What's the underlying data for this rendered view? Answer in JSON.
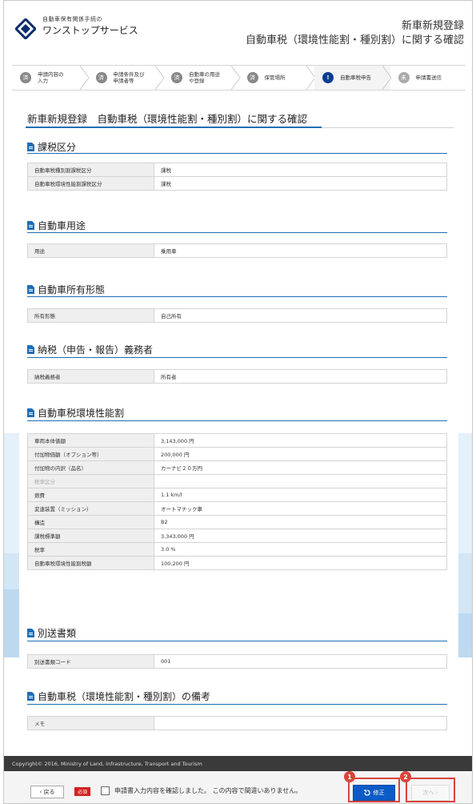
{
  "header": {
    "logo_small": "自動車保有関係手続の",
    "logo_big": "ワンストップサービス",
    "title_line1": "新車新規登録",
    "title_line2": "自動車税（環境性能割・種別割）に関する確認"
  },
  "steps": [
    {
      "num": "済",
      "label": "申請内容の入力"
    },
    {
      "num": "済",
      "label": "申請条件及び申請者等"
    },
    {
      "num": "済",
      "label": "自動車の用途や登録"
    },
    {
      "num": "済",
      "label": "保管場所"
    },
    {
      "num": "!",
      "label": "自動車税申告"
    },
    {
      "num": "未",
      "label": "申請書送信"
    }
  ],
  "main": {
    "page_title": "新車新規登録　自動車税（環境性能割・種別割）に関する確認",
    "sections": {
      "tax_class": {
        "title": "課税区分",
        "rows": [
          {
            "k": "自動車税種別割課税区分",
            "v": "課税"
          },
          {
            "k": "自動車税環境性能割課税区分",
            "v": "課税"
          }
        ]
      },
      "usage": {
        "title": "自動車用途",
        "rows": [
          {
            "k": "用途",
            "v": "乗用車"
          }
        ]
      },
      "ownership": {
        "title": "自動車所有形態",
        "rows": [
          {
            "k": "所有形態",
            "v": "自己所有"
          }
        ]
      },
      "taxpayer": {
        "title": "納税（申告・報告）義務者",
        "rows": [
          {
            "k": "納税義務者",
            "v": "所有者"
          }
        ]
      },
      "env_perf": {
        "title": "自動車税環境性能割",
        "rows": [
          {
            "k": "車両本体価額",
            "v": "3,143,000 円"
          },
          {
            "k": "付加物価額（オプション等）",
            "v": "200,000 円"
          },
          {
            "k": "付加物の内訳（品名）",
            "v": "カーナビ２０万円"
          },
          {
            "k": "税率区分",
            "v": ""
          },
          {
            "k": "燃費",
            "v": "1.1 km/l"
          },
          {
            "k": "変速装置（ミッション）",
            "v": "オートマチック車"
          },
          {
            "k": "構造",
            "v": "B2"
          },
          {
            "k": "課税標準額",
            "v": "3,343,000 円"
          },
          {
            "k": "税率",
            "v": "3.0 %"
          },
          {
            "k": "自動車税環境性能割税額",
            "v": "100,200 円"
          }
        ]
      },
      "separate_docs": {
        "title": "別送書類",
        "rows": [
          {
            "k": "別送書類コード",
            "v": "001"
          }
        ]
      },
      "remarks": {
        "title": "自動車税（環境性能割・種別割）の備考",
        "rows": [
          {
            "k": "メモ",
            "v": ""
          }
        ]
      }
    }
  },
  "footer": {
    "copyright": "Copyright© 2016, Ministry of Land, Infrastructure, Transport and Tourism",
    "back_label": "‹ 戻る",
    "required_badge": "必須",
    "confirm_label": "申請書入力内容を確認しました。 この内容で間違いありません。",
    "fix_label": "修正",
    "next_label": "次へ ›",
    "markers": [
      "1",
      "2"
    ]
  },
  "colors": {
    "accent": "#1f6db5",
    "primary_button": "#0d5bc6",
    "highlight": "#d9443b",
    "required": "#d32020"
  }
}
